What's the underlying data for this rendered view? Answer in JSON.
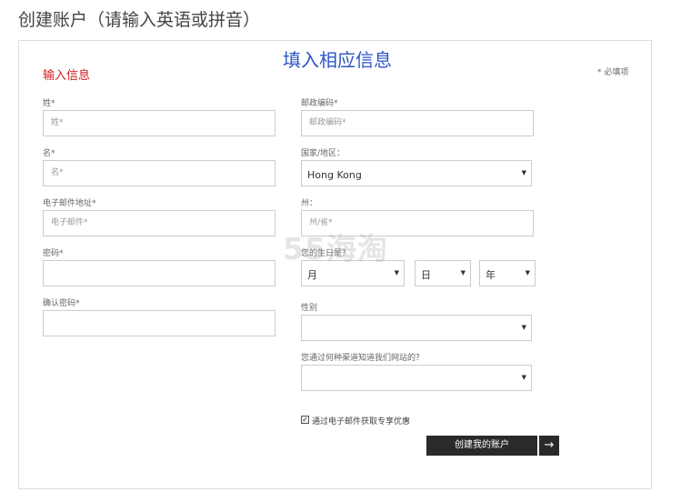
{
  "page": {
    "title": "创建账户（请输入英语或拼音）",
    "overlay_title": "填入相应信息",
    "section_title": "输入信息",
    "required_note": "* 必填项",
    "watermark": "55海淘"
  },
  "form": {
    "last_name": {
      "label": "姓*",
      "placeholder": "姓*"
    },
    "first_name": {
      "label": "名*",
      "placeholder": "名*"
    },
    "email": {
      "label": "电子邮件地址*",
      "placeholder": "电子邮件*"
    },
    "password": {
      "label": "密码*",
      "placeholder": ""
    },
    "confirm_password": {
      "label": "确认密码*",
      "placeholder": ""
    },
    "postal_code": {
      "label": "邮政编码*",
      "placeholder": "邮政编码*"
    },
    "country": {
      "label": "国家/地区：",
      "value": "Hong Kong"
    },
    "state": {
      "label": "州：",
      "placeholder": "州/省*"
    },
    "birthday": {
      "label": "您的生日是？",
      "month": "月",
      "day": "日",
      "year": "年"
    },
    "gender": {
      "label": "性别",
      "value": ""
    },
    "referral": {
      "label": "您通过何种渠道知道我们网站的？",
      "value": ""
    },
    "newsletter": {
      "label": "通过电子邮件获取专享优惠",
      "checked": true
    }
  },
  "actions": {
    "submit_label": "创建我的账户",
    "arrow": "→"
  },
  "icons": {
    "caret": "▼",
    "check": "✓"
  }
}
